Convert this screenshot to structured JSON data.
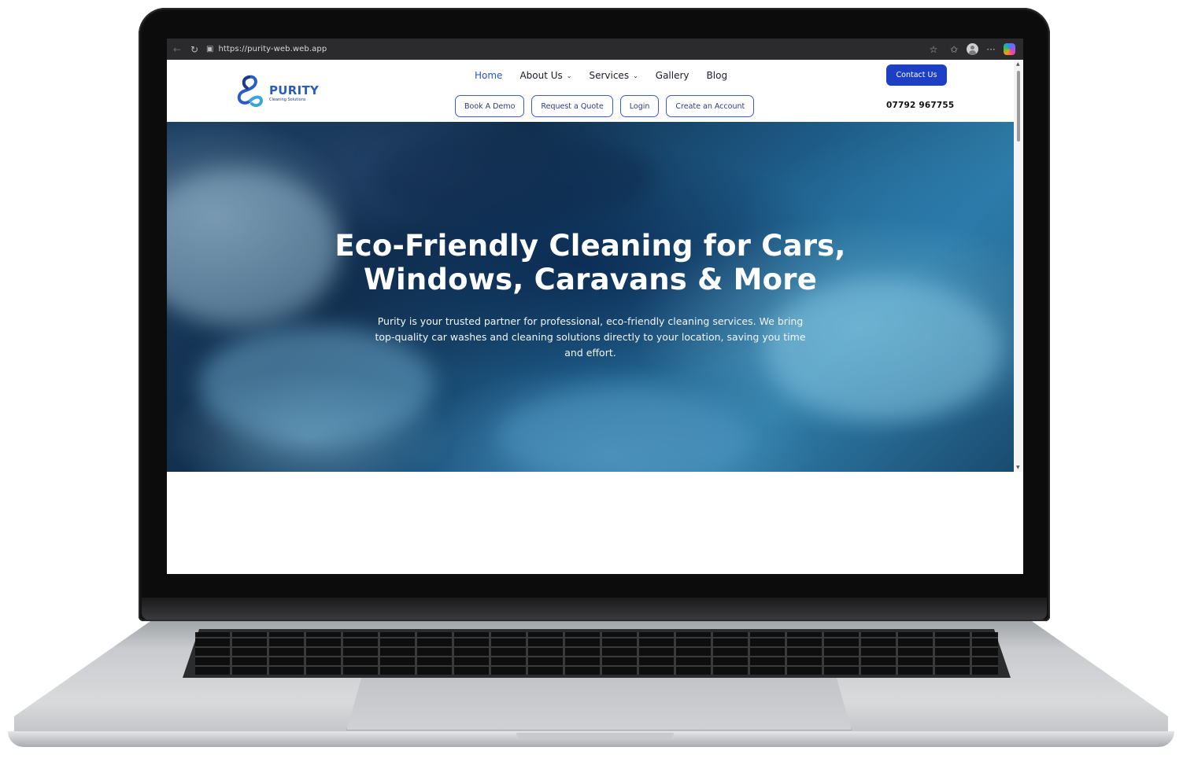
{
  "browser": {
    "url": "https://purity-web.web.app",
    "back_icon": "arrow-left-icon",
    "reload_icon": "reload-icon",
    "lock_icon": "lock-icon"
  },
  "site": {
    "brand": "PURITY",
    "tagline": "Cleaning Solutions",
    "nav": [
      {
        "label": "Home",
        "active": true
      },
      {
        "label": "About Us",
        "dropdown": true
      },
      {
        "label": "Services",
        "dropdown": true
      },
      {
        "label": "Gallery"
      },
      {
        "label": "Blog"
      }
    ],
    "sub_nav": [
      {
        "label": "Book A Demo"
      },
      {
        "label": "Request a Quote"
      },
      {
        "label": "Login"
      },
      {
        "label": "Create an Account"
      }
    ],
    "contact_button": "Contact Us",
    "phone": "07792 967755"
  },
  "hero": {
    "title": "Eco-Friendly Cleaning for Cars, Windows, Caravans & More",
    "text": "Purity is your trusted partner for professional, eco-friendly cleaning services. We bring top-quality car washes and cleaning solutions directly to your location, saving you time and effort."
  },
  "colors": {
    "accent": "#1d3fc4",
    "nav_active": "#2456c7",
    "hero_base": "#1b3e62"
  }
}
